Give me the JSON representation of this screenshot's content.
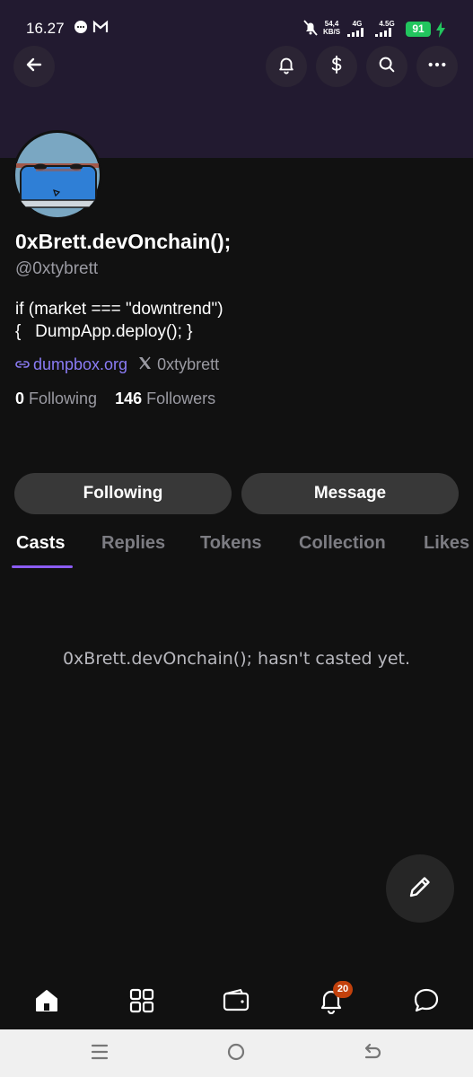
{
  "status_bar": {
    "time": "16.27",
    "net_speed_top": "54,4",
    "net_speed_bottom": "KB/S",
    "network_1": "4G",
    "network_2": "4.5G",
    "battery": "91"
  },
  "header": {
    "icons": [
      "back-arrow-icon",
      "bell-icon",
      "dollar-icon",
      "search-icon",
      "more-icon"
    ]
  },
  "profile": {
    "display_name": "0xBrett.devOnchain();",
    "handle": "@0xtybrett",
    "bio": "if (market === \"downtrend\")\n{   DumpApp.deploy(); }",
    "website": "dumpbox.org",
    "x_handle": "0xtybrett",
    "following_count": "0",
    "following_label": "Following",
    "followers_count": "146",
    "followers_label": "Followers"
  },
  "actions": {
    "following_button": "Following",
    "message_button": "Message"
  },
  "tabs": [
    {
      "label": "Casts",
      "active": true
    },
    {
      "label": "Replies",
      "active": false
    },
    {
      "label": "Tokens",
      "active": false
    },
    {
      "label": "Collection",
      "active": false
    },
    {
      "label": "Likes",
      "active": false
    }
  ],
  "empty_state": "0xBrett.devOnchain(); hasn't casted yet.",
  "bottom_nav": {
    "items": [
      "home-icon",
      "grid-icon",
      "wallet-icon",
      "notifications-icon",
      "chat-icon"
    ],
    "notification_badge": "20"
  },
  "colors": {
    "accent": "#8b5cf6",
    "link": "#8b7cf6",
    "header_bg": "#221a30",
    "background": "#111111",
    "badge": "#c2410c",
    "battery": "#22c55e"
  }
}
